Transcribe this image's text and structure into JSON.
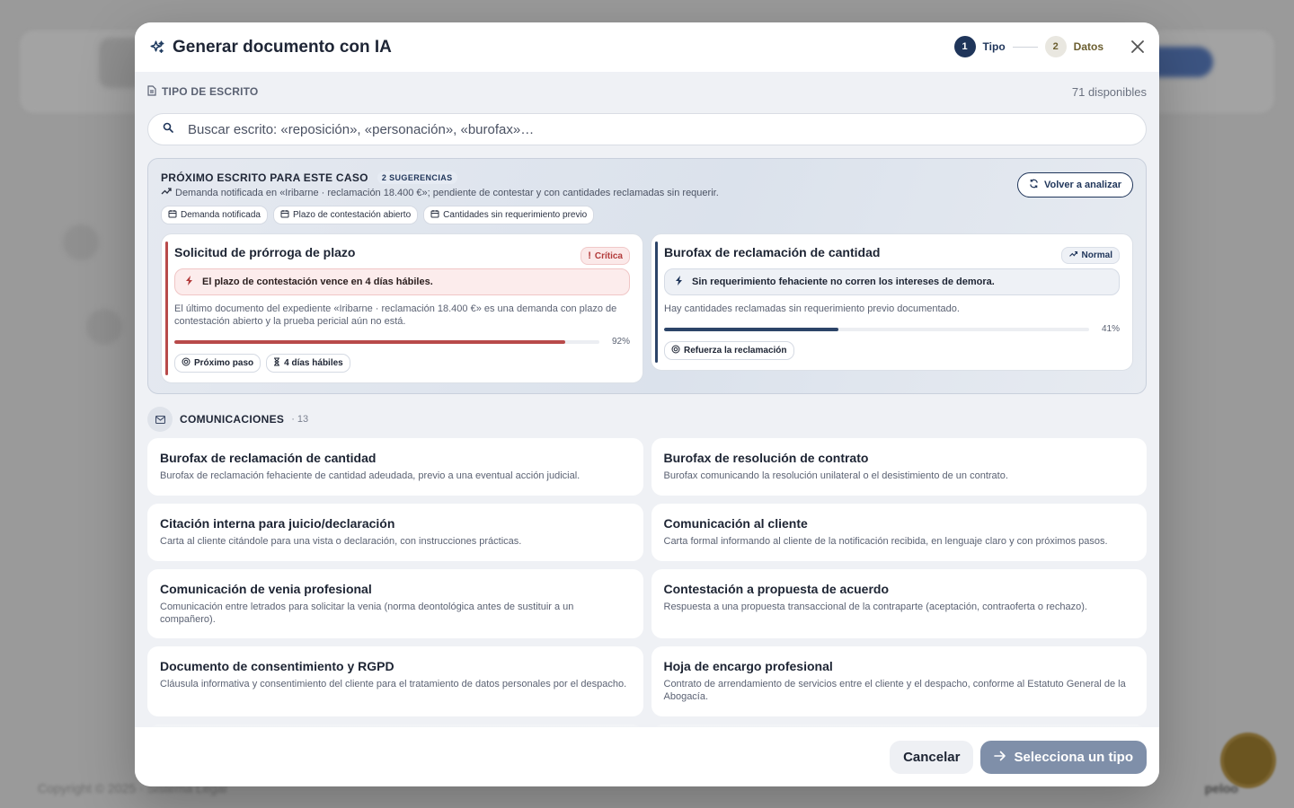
{
  "background": {
    "footer_left": "Copyright © 2025 · Sistema Legal",
    "footer_right": "peloo"
  },
  "modal": {
    "title": "Generar documento con IA",
    "steps": [
      {
        "num": "1",
        "label": "Tipo"
      },
      {
        "num": "2",
        "label": "Datos"
      }
    ]
  },
  "section": {
    "label": "TIPO DE ESCRITO",
    "available": "71 disponibles"
  },
  "search": {
    "placeholder": "Buscar escrito: «reposición», «personación», «burofax»…"
  },
  "suggestions": {
    "title": "PRÓXIMO ESCRITO PARA ESTE CASO",
    "count": "2 SUGERENCIAS",
    "description": "Demanda notificada en «Iribarne · reclamación 18.400 €»; pendiente de contestar y con cantidades reclamadas sin requerir.",
    "reanalyze_label": "Volver a analizar",
    "chips": [
      "Demanda notificada",
      "Plazo de contestación abierto",
      "Cantidades sin requerimiento previo"
    ],
    "cards": [
      {
        "title": "Solicitud de prórroga de plazo",
        "badge": "Crítica",
        "alert": "El plazo de contestación vence en 4 días hábiles.",
        "text": "El último documento del expediente «Iribarne · reclamación 18.400 €» es una demanda con plazo de contestación abierto y la prueba pericial aún no está.",
        "progress": 92,
        "progress_label": "92%",
        "tags": [
          "Próximo paso",
          "4 días hábiles"
        ]
      },
      {
        "title": "Burofax de reclamación de cantidad",
        "badge": "Normal",
        "alert": "Sin requerimiento fehaciente no corren los intereses de demora.",
        "text": "Hay cantidades reclamadas sin requerimiento previo documentado.",
        "progress": 41,
        "progress_label": "41%",
        "tags": [
          "Refuerza la reclamación"
        ]
      }
    ]
  },
  "category": {
    "title": "COMUNICACIONES",
    "count": "· 13",
    "items": [
      {
        "title": "Burofax de reclamación de cantidad",
        "desc": "Burofax de reclamación fehaciente de cantidad adeudada, previo a una eventual acción judicial."
      },
      {
        "title": "Burofax de resolución de contrato",
        "desc": "Burofax comunicando la resolución unilateral o el desistimiento de un contrato."
      },
      {
        "title": "Citación interna para juicio/declaración",
        "desc": "Carta al cliente citándole para una vista o declaración, con instrucciones prácticas."
      },
      {
        "title": "Comunicación al cliente",
        "desc": "Carta formal informando al cliente de la notificación recibida, en lenguaje claro y con próximos pasos."
      },
      {
        "title": "Comunicación de venia profesional",
        "desc": "Comunicación entre letrados para solicitar la venia (norma deontológica antes de sustituir a un compañero)."
      },
      {
        "title": "Contestación a propuesta de acuerdo",
        "desc": "Respuesta a una propuesta transaccional de la contraparte (aceptación, contraoferta o rechazo)."
      },
      {
        "title": "Documento de consentimiento y RGPD",
        "desc": "Cláusula informativa y consentimiento del cliente para el tratamiento de datos personales por el despacho."
      },
      {
        "title": "Hoja de encargo profesional",
        "desc": "Contrato de arrendamiento de servicios entre el cliente y el despacho, conforme al Estatuto General de la Abogacía."
      }
    ]
  },
  "footer": {
    "cancel": "Cancelar",
    "primary": "Selecciona un tipo"
  },
  "colors": {
    "primary": "#1f355a",
    "critical": "#b23a3a",
    "normal_bar": "#2c4468",
    "gold": "#6b5e2f"
  }
}
